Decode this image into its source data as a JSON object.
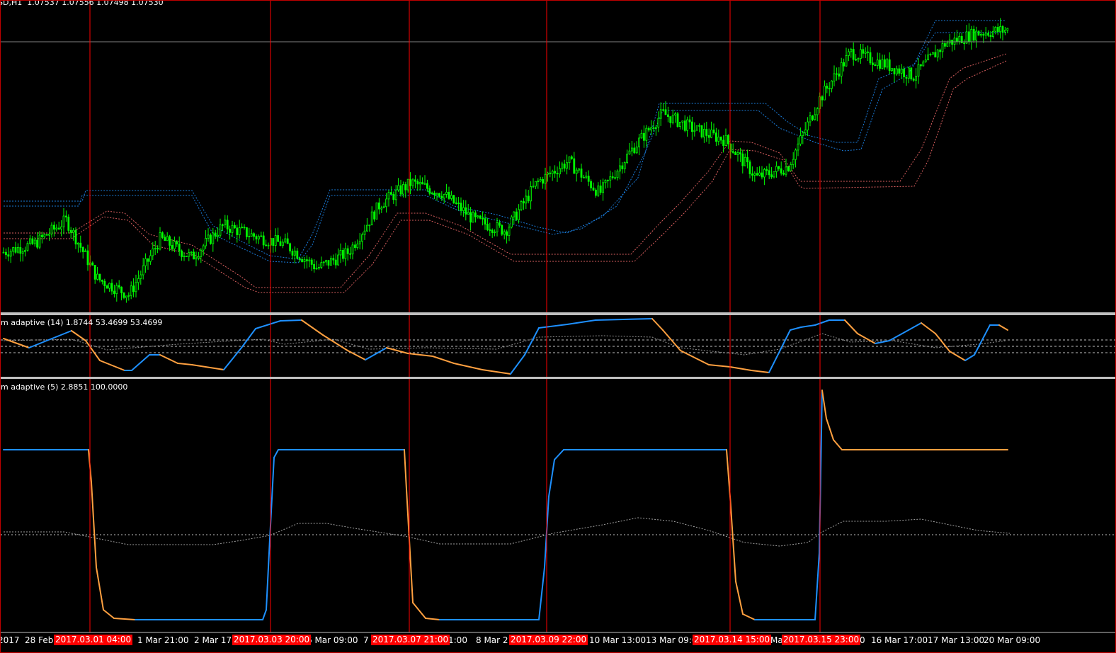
{
  "window": {
    "symbol_title": "SD,H1  1.07537 1.07556 1.07498 1.07530"
  },
  "indicators": [
    {
      "label": "m adaptive (14) 1.8744 53.4699 53.4699"
    },
    {
      "label": "m adaptive (5) 2.8851 100.0000"
    }
  ],
  "time_axis": {
    "labels": [
      "2017",
      "28 Feb",
      "1 Mar 21:00",
      "2 Mar 17:",
      "6 Mar 09:00",
      "7",
      "1:00",
      "8 Mar 21",
      "10 Mar 13:00",
      "13 Mar 09:0",
      "Ma",
      "0",
      "16 Mar 17:00",
      "17 Mar 13:00",
      "20 Mar 09:00"
    ],
    "markers": [
      "2017.03.01 04:00",
      "2017.03.03 20:00",
      "2017.03.07 21:00",
      "2017.03.09 22:00",
      "2017.03.14 15:00",
      "2017.03.15 23:00"
    ]
  },
  "colors": {
    "background": "#000000",
    "candle": "#00ff00",
    "separator": "#ff0000",
    "band_upper": "#1e90ff",
    "band_lower": "#ff7070",
    "rising": "#1e90ff",
    "falling": "#ffa040",
    "level": "#c0c0c0",
    "bid_line": "#808080"
  },
  "chart_data": [
    {
      "type": "line",
      "title": "SD,H1",
      "series": [
        {
          "name": "",
          "values": [
            1.0545,
            1.0553,
            1.0575,
            1.052,
            1.0505,
            1.0558,
            1.054,
            1.057,
            1.056,
            1.0552,
            1.053,
            1.0545,
            1.059,
            1.061,
            1.06,
            1.0575,
            1.0565,
            1.061,
            1.063,
            1.06,
            1.064,
            1.0675,
            1.066,
            1.065,
            1.0615,
            1.0625,
            1.0688,
            1.0732,
            1.0722,
            1.071,
            1.074,
            1.075,
            1.0753
          ]
        }
      ]
    }
  ]
}
